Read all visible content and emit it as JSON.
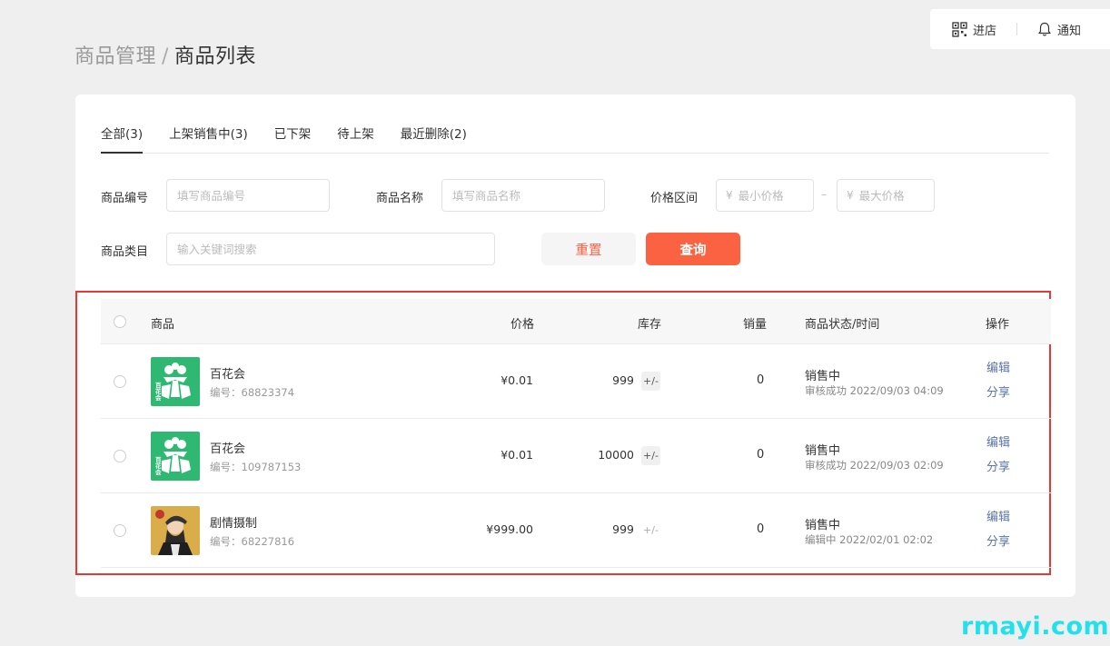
{
  "topbar": {
    "store_label": "进店",
    "notify_label": "通知"
  },
  "breadcrumb": {
    "parent": "商品管理",
    "separator": "/",
    "current": "商品列表"
  },
  "tabs": [
    {
      "label": "全部(3)",
      "active": true
    },
    {
      "label": "上架销售中(3)",
      "active": false
    },
    {
      "label": "已下架",
      "active": false
    },
    {
      "label": "待上架",
      "active": false
    },
    {
      "label": "最近删除(2)",
      "active": false
    }
  ],
  "filters": {
    "code_label": "商品编号",
    "code_placeholder": "填写商品编号",
    "name_label": "商品名称",
    "name_placeholder": "填写商品名称",
    "price_label": "价格区间",
    "currency": "¥",
    "min_placeholder": "最小价格",
    "dash": "–",
    "max_placeholder": "最大价格",
    "category_label": "商品类目",
    "category_placeholder": "输入关键词搜索",
    "reset_label": "重置",
    "query_label": "查询"
  },
  "table": {
    "headers": {
      "product": "商品",
      "price": "价格",
      "stock": "库存",
      "sales": "销量",
      "status": "商品状态/时间",
      "ops": "操作"
    },
    "stock_adjust": "+/-",
    "edit_label": "编辑",
    "share_label": "分享",
    "rows": [
      {
        "name": "百花会",
        "code": "编号：68823374",
        "price": "¥0.01",
        "stock": "999",
        "sales": "0",
        "status": "销售中",
        "status_time": "审核成功 2022/09/03 04:09",
        "thumb": "green-logo"
      },
      {
        "name": "百花会",
        "code": "编号：109787153",
        "price": "¥0.01",
        "stock": "10000",
        "sales": "0",
        "status": "销售中",
        "status_time": "审核成功 2022/09/03 02:09",
        "thumb": "green-logo"
      },
      {
        "name": "剧情摄制",
        "code": "编号：68227816",
        "price": "¥999.00",
        "stock": "999",
        "sales": "0",
        "status": "销售中",
        "status_time": "编辑中 2022/02/01 02:02",
        "thumb": "person-photo"
      }
    ]
  },
  "colors": {
    "accent": "#fa6241",
    "highlight_border": "#e53935",
    "link": "#5a74a8",
    "thumb_green": "#2eb872"
  },
  "watermark": "rmayi.com"
}
